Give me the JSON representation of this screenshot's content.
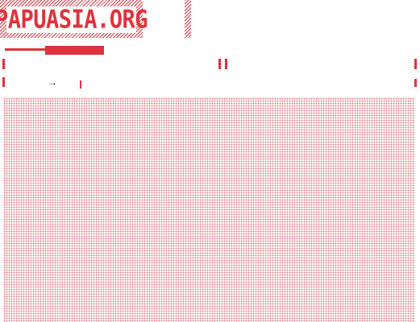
{
  "site": {
    "logo_text": "PAPUASIA.ORG"
  },
  "nav": {
    "next_arrow": "→"
  },
  "colors": {
    "accent": "#e0323c",
    "dot_pattern": "#e07a80",
    "background": "#ffffff"
  },
  "icons": {
    "next": "arrow-right-icon"
  }
}
